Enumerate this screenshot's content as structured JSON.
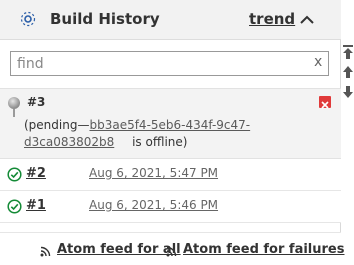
{
  "header": {
    "title": "Build History",
    "trend_label": "trend",
    "icon": "gear-icon",
    "collapse_icon": "chevron-up-icon"
  },
  "search": {
    "placeholder": "find",
    "value": "",
    "clear_label": "x"
  },
  "scroll_nav": [
    "scroll-top-icon",
    "scroll-up-icon",
    "scroll-down-icon"
  ],
  "pending_build": {
    "number": "#3",
    "prefix": "(pending—",
    "link_line1": "bb3ae5f4-5eb6-434f-9c47-",
    "link_line2": "d3ca083802b8",
    "suffix": "is offline)",
    "status_icon": "grey-ball-icon",
    "cancel_icon": "cancel-icon"
  },
  "builds": [
    {
      "number": "#2",
      "date": "Aug 6, 2021, 5:47 PM",
      "status": "success"
    },
    {
      "number": "#1",
      "date": "Aug 6, 2021, 5:46 PM",
      "status": "success"
    }
  ],
  "feeds": {
    "all_label": "Atom feed for all",
    "failures_label": "Atom feed for failures"
  },
  "colors": {
    "header_bg": "#f2f2f2",
    "pending_bg": "#f3f3f3",
    "success": "#138a36",
    "cancel": "#e03a3a"
  }
}
